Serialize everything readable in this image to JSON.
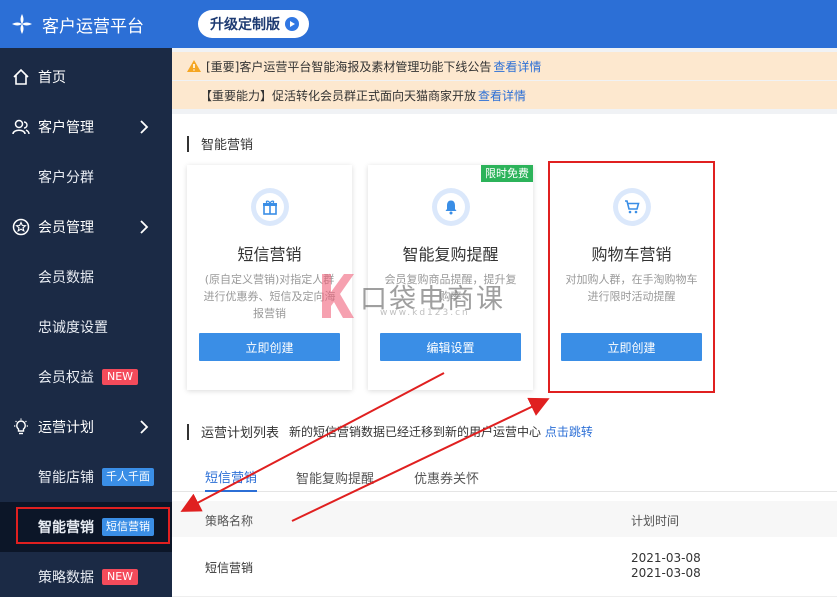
{
  "app": {
    "title": "客户运营平台"
  },
  "header": {
    "upgrade_label": "升级定制版"
  },
  "notices": [
    {
      "text": "[重要]客户运营平台智能海报及素材管理功能下线公告",
      "link": "查看详情"
    },
    {
      "text": "【重要能力】促活转化会员群正式面向天猫商家开放",
      "link": "查看详情"
    }
  ],
  "sidebar": {
    "items": [
      {
        "label": "首页",
        "icon": "home-icon"
      },
      {
        "label": "客户管理",
        "icon": "users-icon"
      },
      {
        "label": "客户分群"
      },
      {
        "label": "会员管理",
        "icon": "star-icon"
      },
      {
        "label": "会员数据"
      },
      {
        "label": "忠诚度设置"
      },
      {
        "label": "会员权益",
        "badge": "NEW"
      },
      {
        "label": "运营计划",
        "icon": "bulb-icon"
      },
      {
        "label": "智能店铺",
        "badge": "千人千面"
      },
      {
        "label": "智能营销",
        "badge": "短信营销"
      },
      {
        "label": "策略数据",
        "badge": "NEW"
      }
    ]
  },
  "main": {
    "section_title": "智能营销",
    "cards": [
      {
        "title": "短信营销",
        "desc": "(原自定义营销)对指定人群进行优惠券、短信及定向海报营销",
        "button": "立即创建",
        "icon": "gift-icon"
      },
      {
        "title": "智能复购提醒",
        "desc": "会员复购商品提醒，提升复购率",
        "button": "编辑设置",
        "icon": "bell-icon",
        "tag": "限时免费"
      },
      {
        "title": "购物车营销",
        "desc": "对加购人群，在手淘购物车进行限时活动提醒",
        "button": "立即创建",
        "icon": "cart-icon"
      }
    ],
    "plan_title": "运营计划列表",
    "plan_desc": "新的短信营销数据已经迁移到新的用户运营中心",
    "plan_link": "点击跳转",
    "tabs": [
      "短信营销",
      "智能复购提醒",
      "优惠券关怀"
    ],
    "table": {
      "columns": [
        "策略名称",
        "计划时间"
      ],
      "rows": [
        {
          "name": "短信营销",
          "time_start": "2021-03-08",
          "time_end": "2021-03-08"
        }
      ]
    }
  },
  "watermark": {
    "text": "口袋电商课",
    "url": "www.kd123.cn"
  },
  "colors": {
    "primary": "#2c6fd6",
    "sidebar": "#1b2a45",
    "accent_red": "#e02020",
    "notice_bg": "#fde8cf"
  }
}
